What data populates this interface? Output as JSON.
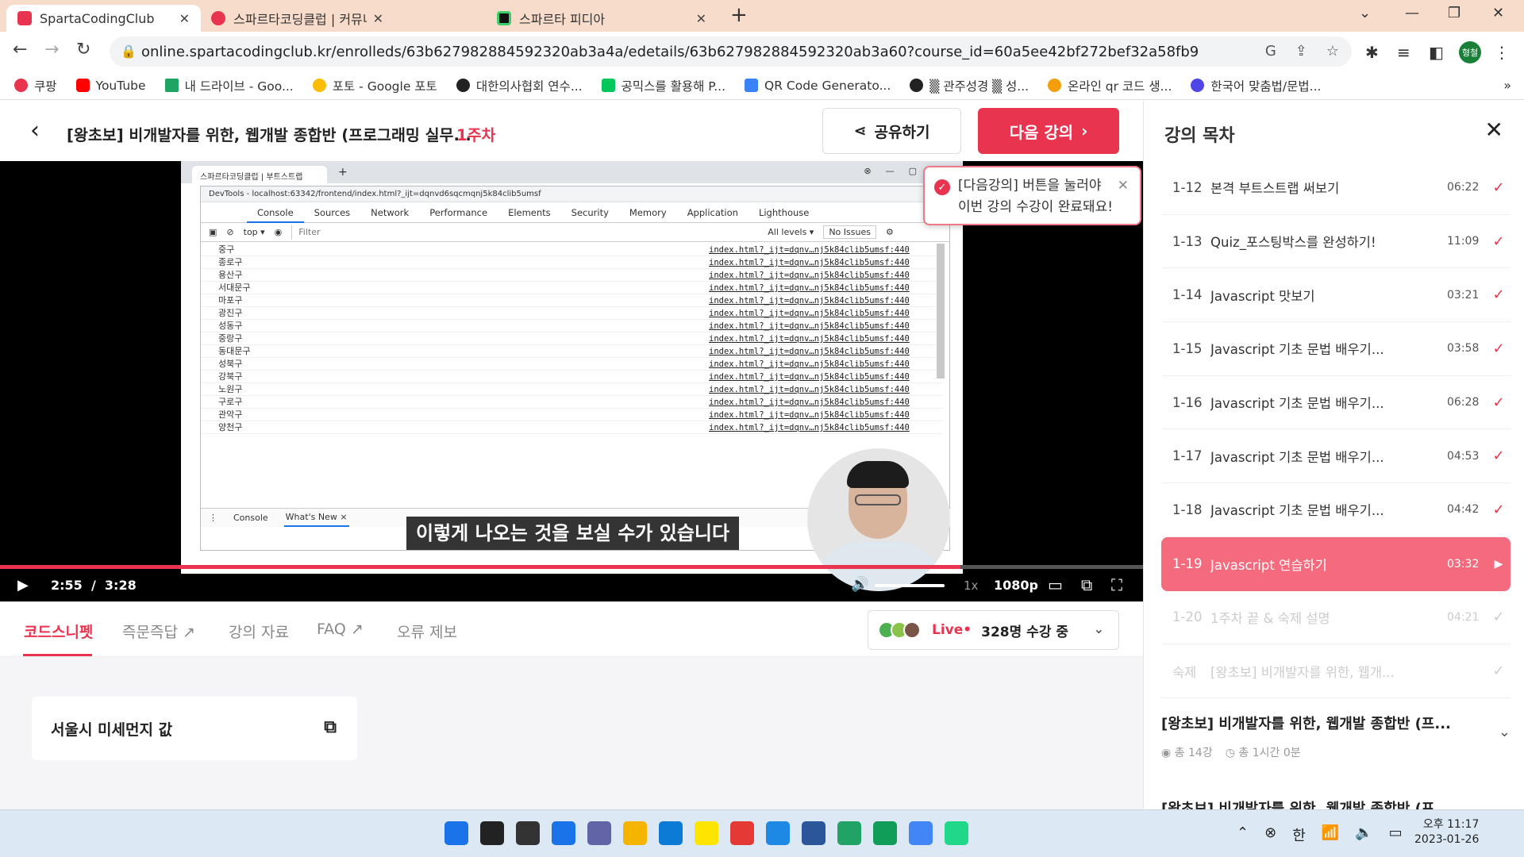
{
  "browser": {
    "tabs": [
      {
        "title": "SpartaCodingClub",
        "active": true,
        "color": "#e8344e"
      },
      {
        "title": "스파르타코딩클럽 | 커뮤니티",
        "active": false,
        "color": "#e8344e"
      },
      {
        "title": "스파르타 피디아",
        "active": false,
        "color": "#111111"
      }
    ],
    "new_tab": "+",
    "url": "online.spartacodingclub.kr/enrolleds/63b627982884592320ab3a4a/edetails/63b627982884592320ab3a60?course_id=60a5ee42bf272bef32a58fb9",
    "profile_initials": "형철",
    "bookmarks": [
      {
        "label": "쿠팡",
        "color": "#e8344e"
      },
      {
        "label": "YouTube",
        "color": "#ff0000"
      },
      {
        "label": "내 드라이브 - Goo...",
        "color": "#1fa463"
      },
      {
        "label": "포토 - Google 포토",
        "color": "#fbbc04"
      },
      {
        "label": "대한의사협회 연수...",
        "color": "#222222"
      },
      {
        "label": "공믹스를 활용해 P...",
        "color": "#03c75a"
      },
      {
        "label": "QR Code Generato...",
        "color": "#3b82f6"
      },
      {
        "label": "▒ 관주성경 ▒ 성...",
        "color": "#222222"
      },
      {
        "label": "온라인 qr 코드 생...",
        "color": "#f59e0b"
      },
      {
        "label": "한국어 맞춤법/문법...",
        "color": "#4f46e5"
      }
    ]
  },
  "header": {
    "course_title": "[왕초보] 비개발자를 위한, 웹개발 종합반 (프로그래밍 실무...",
    "week": "1주차",
    "share_label": "공유하기",
    "next_label": "다음 강의"
  },
  "callout": {
    "line1": "[다음강의] 버튼을 눌러야",
    "line2": "이번 강의 수강이 완료돼요!"
  },
  "video": {
    "subtitle": "이렇게 나오는 것을 보실 수가 있습니다",
    "current_time": "2:55",
    "separator": "/",
    "duration": "3:28",
    "progress": 0.84,
    "speed": "1x",
    "quality": "1080p",
    "devtools": {
      "window_tab": "스파르타코딩클럽 | 부트스트랩",
      "title": "DevTools - localhost:63342/frontend/index.html?_ijt=dqnvd6sqcmqnj5k84clib5umsf",
      "tabs": [
        "Console",
        "Sources",
        "Network",
        "Performance",
        "Elements",
        "Security",
        "Memory",
        "Application",
        "Lighthouse"
      ],
      "context": "top ▾",
      "filter_placeholder": "Filter",
      "levels": "All levels ▾",
      "issues": "No Issues",
      "source": "index.html?_ijt=dqnv…nj5k84clib5umsf:440",
      "logs": [
        "중구",
        "종로구",
        "용산구",
        "서대문구",
        "마포구",
        "광진구",
        "성동구",
        "중랑구",
        "동대문구",
        "성북구",
        "강북구",
        "노원구",
        "구로구",
        "관악구",
        "양천구"
      ],
      "drawer_tabs": [
        "Console",
        "What's New ×"
      ]
    }
  },
  "below": {
    "tabs": [
      "코드스니펫",
      "즉문즉답 ↗",
      "강의 자료",
      "FAQ ↗",
      "오류 제보"
    ],
    "live_label": "Live•",
    "live_count": "328명 수강 중",
    "snippet_title": "서울시 미세먼지 값"
  },
  "sidebar": {
    "title": "강의 목차",
    "lessons": [
      {
        "num": "1-12",
        "title": "본격 부트스트랩 써보기",
        "dur": "06:22",
        "state": "done"
      },
      {
        "num": "1-13",
        "title": "Quiz_포스팅박스를 완성하기!",
        "dur": "11:09",
        "state": "done"
      },
      {
        "num": "1-14",
        "title": "Javascript 맛보기",
        "dur": "03:21",
        "state": "done"
      },
      {
        "num": "1-15",
        "title": "Javascript 기초 문법 배우기...",
        "dur": "03:58",
        "state": "done"
      },
      {
        "num": "1-16",
        "title": "Javascript 기초 문법 배우기...",
        "dur": "06:28",
        "state": "done"
      },
      {
        "num": "1-17",
        "title": "Javascript 기초 문법 배우기...",
        "dur": "04:53",
        "state": "done"
      },
      {
        "num": "1-18",
        "title": "Javascript 기초 문법 배우기...",
        "dur": "04:42",
        "state": "done"
      },
      {
        "num": "1-19",
        "title": "Javascript 연습하기",
        "dur": "03:32",
        "state": "current"
      },
      {
        "num": "1-20",
        "title": "1주차 끝 & 숙제 설명",
        "dur": "04:21",
        "state": "future"
      },
      {
        "num": "숙제",
        "title": "[왕초보] 비개발자를 위한, 웹개...",
        "dur": "",
        "state": "future"
      }
    ],
    "section_title": "[왕초보] 비개발자를 위한, 웹개발 종합반 (프...",
    "section_lessons": "총 14강",
    "section_duration": "총 1시간 0분",
    "next_section_title": "[왕초보] 비개발자를 위한, 웹개발 종합반 (프..."
  },
  "taskbar": {
    "apps": [
      {
        "name": "start",
        "color": "#1a73e8"
      },
      {
        "name": "search",
        "color": "#222222"
      },
      {
        "name": "task-view",
        "color": "#333333"
      },
      {
        "name": "widgets",
        "color": "#1a73e8"
      },
      {
        "name": "teams-chat",
        "color": "#6264a7"
      },
      {
        "name": "file-explorer",
        "color": "#f4b400"
      },
      {
        "name": "edge",
        "color": "#0c7bd6"
      },
      {
        "name": "kakaotalk",
        "color": "#fee500"
      },
      {
        "name": "pdf-app",
        "color": "#e53935"
      },
      {
        "name": "phone-app",
        "color": "#1e88e5"
      },
      {
        "name": "word",
        "color": "#2b579a"
      },
      {
        "name": "vscode-like",
        "color": "#21a366"
      },
      {
        "name": "app-green",
        "color": "#0f9d58"
      },
      {
        "name": "chrome",
        "color": "#4285f4"
      },
      {
        "name": "pycharm",
        "color": "#21d789"
      }
    ],
    "ime": "한",
    "time": "오후 11:17",
    "date": "2023-01-26"
  }
}
